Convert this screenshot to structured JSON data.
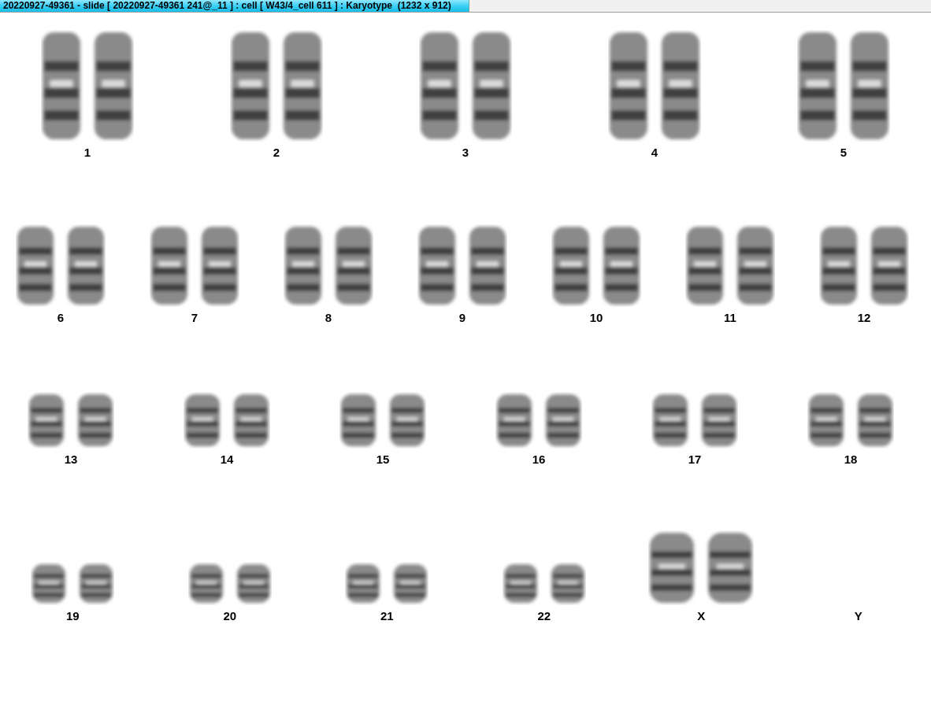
{
  "window": {
    "title": "20220927-49361 - slide [ 20220927-49361 241@_11 ] : cell [ W43/4_cell 611 ] : Karyotype  (1232 x 912)"
  },
  "rows": [
    {
      "pairs": [
        {
          "label": "1",
          "kind": "pair"
        },
        {
          "label": "2",
          "kind": "pair"
        },
        {
          "label": "3",
          "kind": "pair"
        },
        {
          "label": "4",
          "kind": "pair"
        },
        {
          "label": "5",
          "kind": "pair"
        }
      ]
    },
    {
      "pairs": [
        {
          "label": "6",
          "kind": "pair"
        },
        {
          "label": "7",
          "kind": "pair"
        },
        {
          "label": "8",
          "kind": "pair"
        },
        {
          "label": "9",
          "kind": "pair"
        },
        {
          "label": "10",
          "kind": "pair"
        },
        {
          "label": "11",
          "kind": "pair"
        },
        {
          "label": "12",
          "kind": "pair"
        }
      ]
    },
    {
      "pairs": [
        {
          "label": "13",
          "kind": "pair"
        },
        {
          "label": "14",
          "kind": "pair"
        },
        {
          "label": "15",
          "kind": "pair"
        },
        {
          "label": "16",
          "kind": "pair"
        },
        {
          "label": "17",
          "kind": "pair"
        },
        {
          "label": "18",
          "kind": "pair"
        }
      ]
    },
    {
      "pairs": [
        {
          "label": "19",
          "kind": "pair"
        },
        {
          "label": "20",
          "kind": "pair"
        },
        {
          "label": "21",
          "kind": "pair"
        },
        {
          "label": "22",
          "kind": "pair"
        },
        {
          "label": "X",
          "kind": "large-pair"
        },
        {
          "label": "Y",
          "kind": "empty"
        }
      ]
    }
  ]
}
